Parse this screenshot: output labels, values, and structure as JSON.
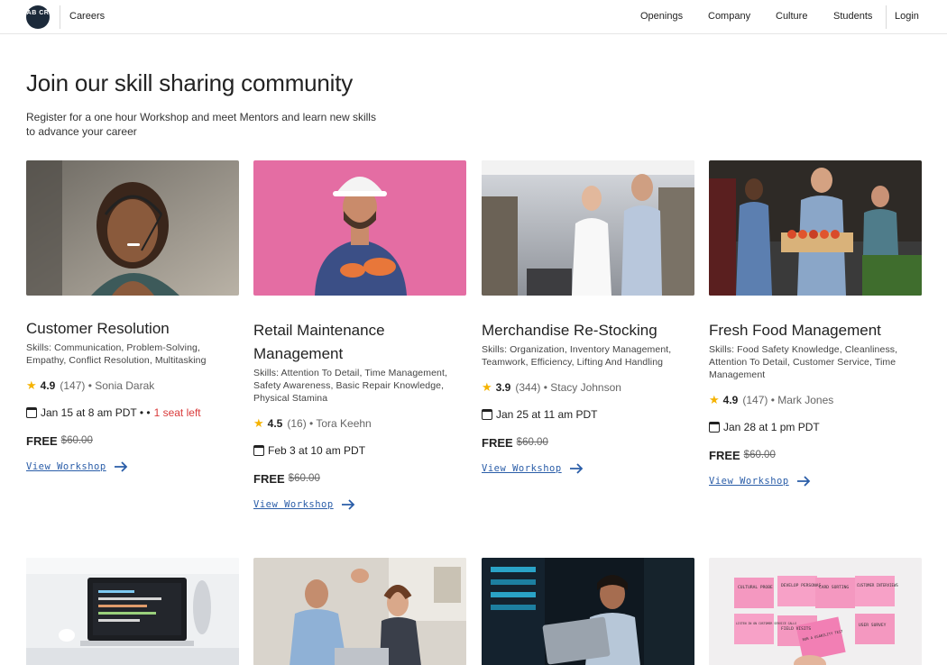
{
  "header": {
    "logo_text": "AB CR",
    "brand": "Careers",
    "nav": [
      {
        "label": "Openings"
      },
      {
        "label": "Company"
      },
      {
        "label": "Culture"
      },
      {
        "label": "Students"
      }
    ],
    "login": "Login"
  },
  "hero": {
    "title": "Join our skill sharing community",
    "subtitle": "Register for a one hour Workshop and meet Mentors and learn new skills to advance your career"
  },
  "workshops": [
    {
      "title": "Customer Resolution",
      "skills": "Skills: Communication, Problem-Solving, Empathy, Conflict Resolution, Multitasking",
      "rating": "4.9",
      "reviews": "(147)",
      "mentor": "• Sonia Darak",
      "date": "Jan 15 at 8 am PDT • •",
      "seats": "1 seat left",
      "price": "FREE",
      "old_price": "$60.00",
      "link": "View Workshop"
    },
    {
      "title": "Retail Maintenance Management",
      "skills": "Skills: Attention To Detail, Time Management, Safety Awareness, Basic Repair Knowledge, Physical Stamina",
      "rating": "4.5",
      "reviews": "(16)",
      "mentor": "• Tora Keehn",
      "date": "Feb 3 at 10 am PDT",
      "price": "FREE",
      "old_price": "$60.00",
      "link": "View Workshop"
    },
    {
      "title": "Merchandise Re-Stocking",
      "skills": "Skills: Organization, Inventory Management, Teamwork, Efficiency, Lifting And Handling",
      "rating": "3.9",
      "reviews": "(344)",
      "mentor": "• Stacy Johnson",
      "date": "Jan 25 at 11 am PDT",
      "price": "FREE",
      "old_price": "$60.00",
      "link": "View Workshop"
    },
    {
      "title": "Fresh Food Management",
      "skills": "Skills: Food Safety Knowledge, Cleanliness, Attention To Detail, Customer Service, Time Management",
      "rating": "4.9",
      "reviews": "(147)",
      "mentor": "• Mark Jones",
      "date": "Jan 28 at 1 pm PDT",
      "price": "FREE",
      "old_price": "$60.00",
      "link": "View Workshop"
    }
  ],
  "sticky_notes": [
    "CULTURAL PROBE",
    "DEVELOP PERSONAS",
    "CARD SORTING",
    "CUSTOMER INTERVIEWS",
    "LISTEN IN ON CUSTOMER SERVICE CALLS",
    "FIELD VISITS",
    "RUN A USABILITY TEST",
    "USER SURVEY"
  ],
  "colors": {
    "accent_link": "#2a5da8",
    "seat_warning": "#d93a3a",
    "star": "#f5b301",
    "logo_bg": "#1c2a3a"
  }
}
